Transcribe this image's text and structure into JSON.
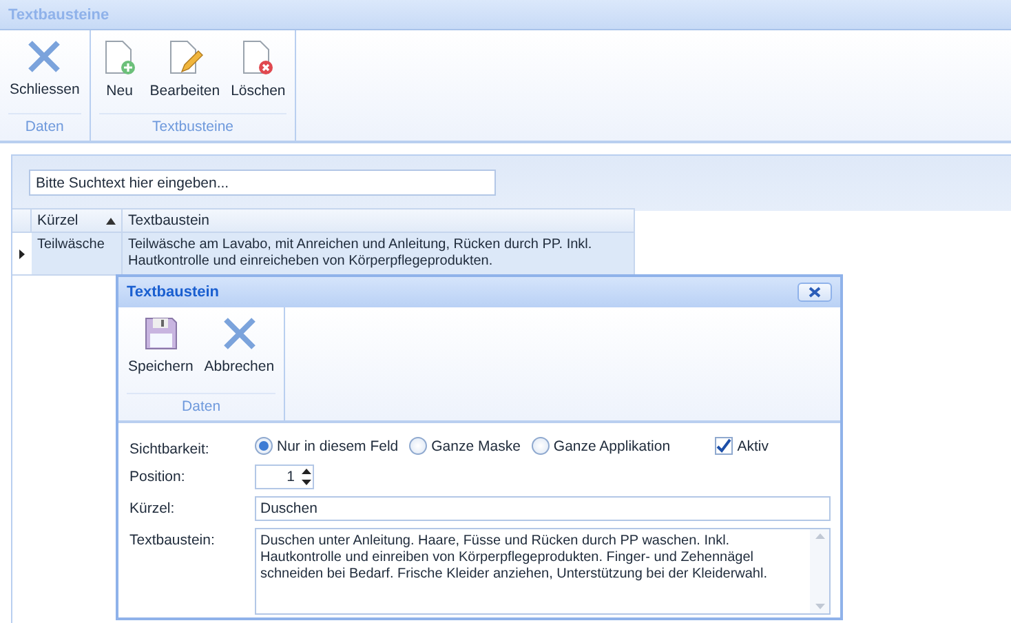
{
  "window": {
    "title": "Textbausteine"
  },
  "ribbon": {
    "groups": [
      {
        "label": "Daten",
        "buttons": [
          {
            "label": "Schliessen",
            "kind": "close"
          }
        ]
      },
      {
        "label": "Textbusteine",
        "buttons": [
          {
            "label": "Neu",
            "kind": "new"
          },
          {
            "label": "Bearbeiten",
            "kind": "edit"
          },
          {
            "label": "Löschen",
            "kind": "delete"
          }
        ]
      }
    ]
  },
  "search": {
    "placeholder": "Bitte Suchtext hier eingeben..."
  },
  "table": {
    "columns": [
      {
        "label": "Kürzel",
        "sorted": true
      },
      {
        "label": "Textbaustein",
        "sorted": false
      }
    ],
    "rows": [
      {
        "selected": true,
        "cells": [
          "Teilwäsche",
          "Teilwäsche am Lavabo, mit Anreichen und Anleitung, Rücken durch PP. Inkl. Hautkontrolle und einreicheben von Körperpflegeprodukten."
        ]
      }
    ]
  },
  "dialog": {
    "title": "Textbaustein",
    "ribbon": {
      "groups": [
        {
          "label": "Daten",
          "buttons": [
            {
              "label": "Speichern",
              "kind": "save"
            },
            {
              "label": "Abbrechen",
              "kind": "close"
            }
          ]
        }
      ]
    },
    "visibility": {
      "label": "Sichtbarkeit:",
      "options": [
        {
          "label": "Nur in diesem Feld",
          "selected": true
        },
        {
          "label": "Ganze Maske",
          "selected": false
        },
        {
          "label": "Ganze Applikation",
          "selected": false
        }
      ]
    },
    "active": {
      "label": "Aktiv",
      "checked": true
    },
    "position": {
      "label": "Position:",
      "value": "1"
    },
    "short": {
      "label": "Kürzel:",
      "value": "Duschen"
    },
    "body": {
      "label": "Textbaustein:",
      "value": "Duschen unter Anleitung. Haare, Füsse und Rücken durch PP waschen. Inkl. Hautkontrolle und einreiben von Körperpflegeprodukten. Finger- und Zehennägel schneiden bei Bedarf. Frische Kleider anziehen, Unterstützung bei der Kleiderwahl."
    }
  }
}
